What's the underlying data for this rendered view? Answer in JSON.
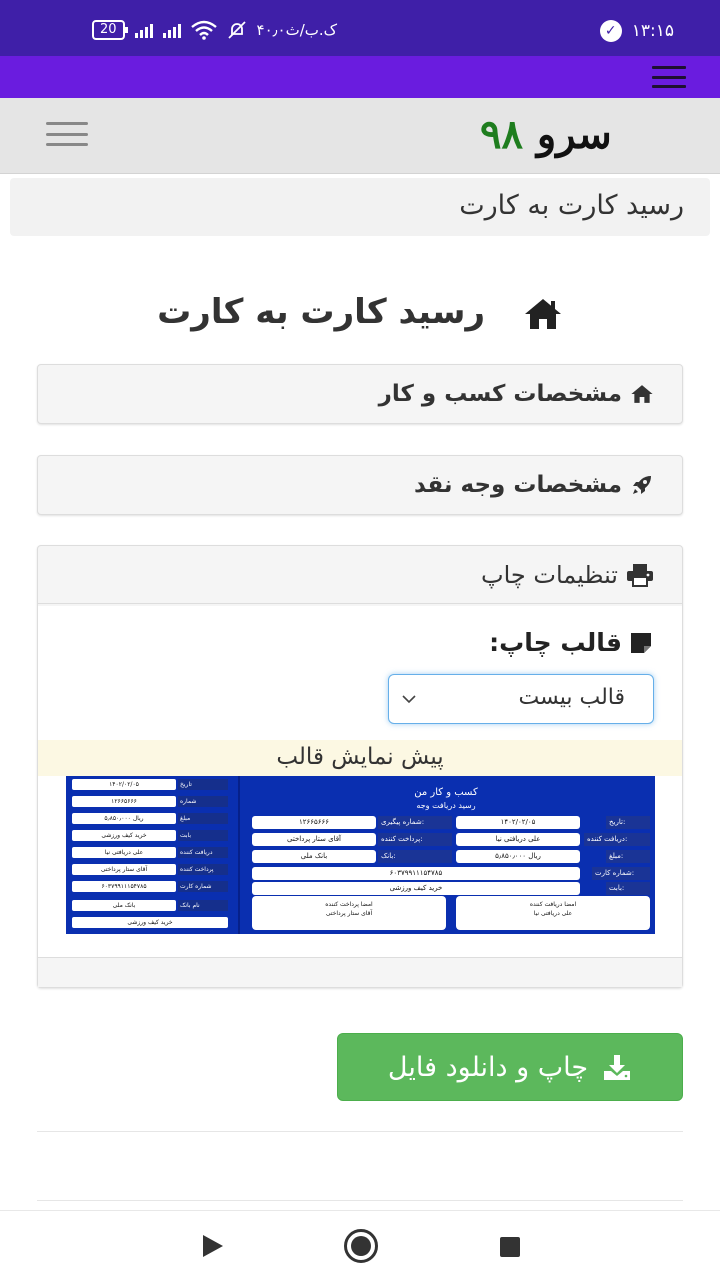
{
  "status_bar": {
    "time": "۱۳:۱۵",
    "network_speed": "۴۰٫۰ک.ب/ث",
    "battery": "20"
  },
  "site": {
    "logo_word": "سرو",
    "logo_number": "۹۸",
    "logo_word_color": "#111111",
    "logo_number_color": "#1e7d1e"
  },
  "breadcrumb": "رسید کارت به کارت",
  "page_title": "رسید کارت به کارت",
  "panels": {
    "business": "مشخصات کسب و کار",
    "cash": "مشخصات وجه نقد",
    "print_settings": "تنظیمات چاپ"
  },
  "print": {
    "template_label": "قالب چاپ:",
    "template_selected": "قالب بیست",
    "preview_label": "پیش نمایش قالب"
  },
  "receipt": {
    "business_name": "کسب و کار من",
    "subtitle": "رسید دریافت وجه",
    "left_rows": [
      {
        "key": "تاریخ",
        "value": "۱۴۰۲/۰۲/۰۵"
      },
      {
        "key": "شماره",
        "value": "۱۲۶۶۵۶۶۶"
      },
      {
        "key": "مبلغ",
        "value": "۵٫۸۵۰٫۰۰۰ ریال"
      },
      {
        "key": "بابت",
        "value": "خرید کیف ورزشی"
      },
      {
        "key": "دریافت کننده",
        "value": "علی دریافتی نیا"
      },
      {
        "key": "پرداخت کننده",
        "value": "آقای ستار پرداختی"
      },
      {
        "key": "شماره کارت",
        "value": "۶۰۳۷۹۹۱۱۱۵۴۷۸۵"
      },
      {
        "key": "نام بانک",
        "value": "بانک ملی"
      }
    ],
    "left_footer": "خرید کیف ورزشی",
    "date_label": "تاریخ:",
    "date_value": "۱۴۰۲/۰۲/۰۵",
    "tracking_label": "شماره پیگیری:",
    "tracking_value": "۱۲۶۶۵۶۶۶",
    "receiver_label": "دریافت کننده:",
    "receiver_value": "علی دریافتی نیا",
    "payer_label": "پرداخت کننده:",
    "payer_value": "آقای ستار پرداختی",
    "amount_label": "مبلغ:",
    "amount_value": "۵٫۸۵۰٫۰۰۰ ریال",
    "bank_label": "بانک:",
    "bank_value": "بانک ملی",
    "card_label": "شماره کارت:",
    "card_value": "۶۰۳۷۹۹۱۱۱۵۴۷۸۵",
    "for_label": "بابت:",
    "for_value": "خرید کیف ورزشی",
    "sign_receiver_title": "امضا دریافت کننده",
    "sign_receiver_name": "علی دریافتی نیا",
    "sign_payer_title": "امضا پرداخت کننده",
    "sign_payer_name": "آقای ستار پرداختی"
  },
  "download_button": "چاپ و دانلود فایل",
  "colors": {
    "status_bar": "#3f1fa8",
    "app_bar": "#6a1cdf",
    "button_green": "#5cb85c",
    "receipt_blue": "#0a2fb0"
  }
}
